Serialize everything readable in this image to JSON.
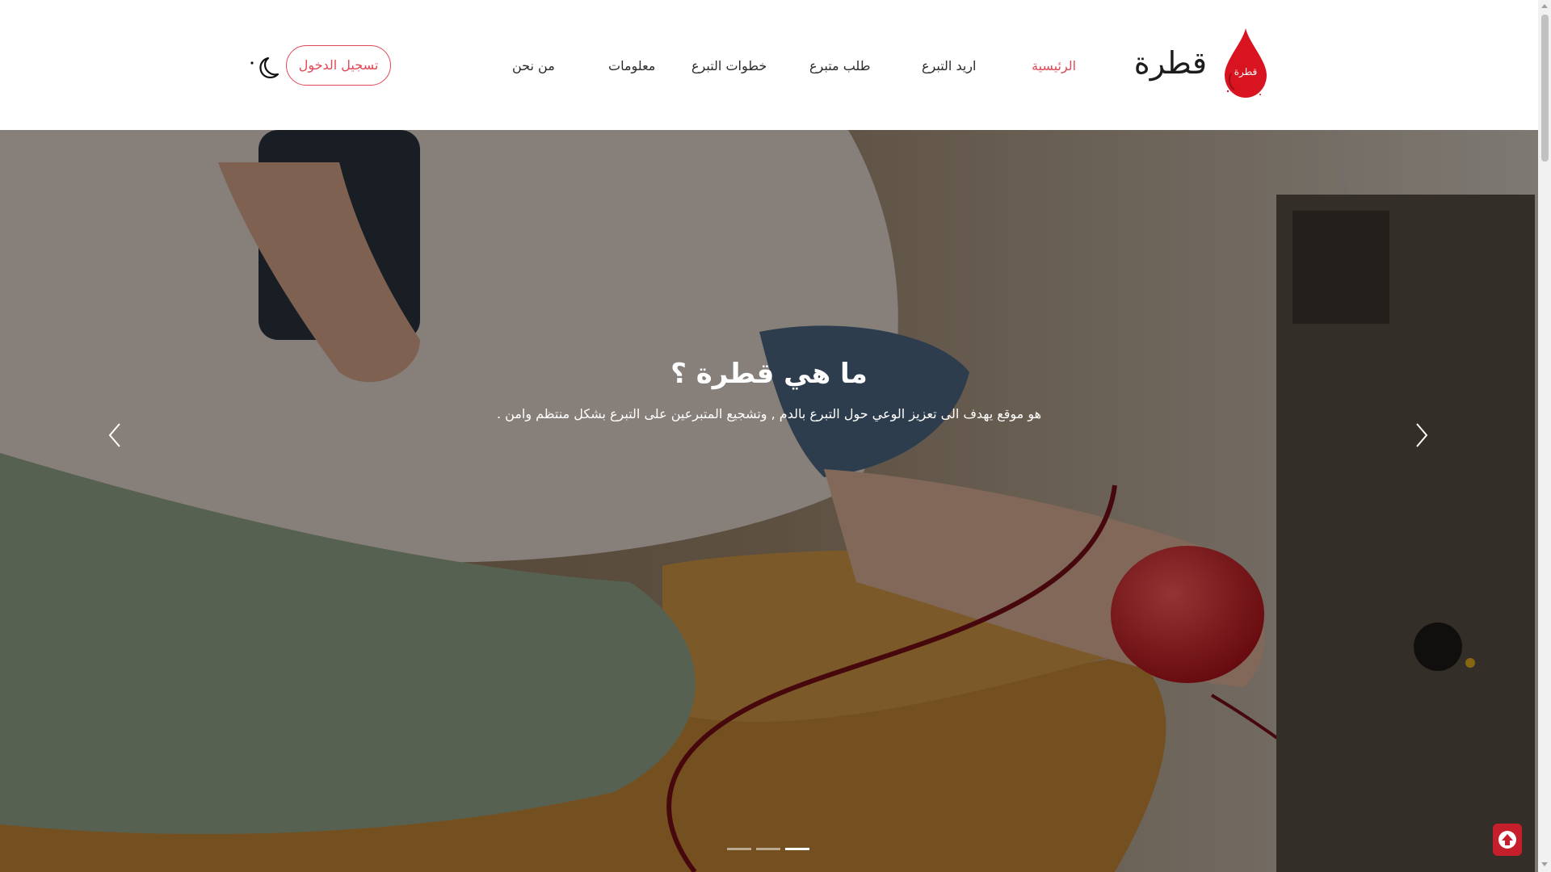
{
  "brand": {
    "name": "قطرة",
    "drop_label": "قطرة",
    "accent_color": "#e04a56",
    "drop_color": "#d7141f"
  },
  "nav": {
    "items": [
      {
        "label": "الرئيسية",
        "active": true
      },
      {
        "label": "اريد التبرع",
        "active": false
      },
      {
        "label": "طلب متبرع",
        "active": false
      },
      {
        "label": "خطوات التبرع",
        "active": false
      },
      {
        "label": "معلومات",
        "active": false
      },
      {
        "label": "من نحن",
        "active": false
      }
    ],
    "login_label": "تسجيل الدخول",
    "theme_toggle_icon": "moon-icon"
  },
  "hero": {
    "title": "ما هي قطرة ؟",
    "subtitle": "هو موقع يهدف الى تعزيز الوعي حول التبرع بالدم , وتشجيع المتبرعين على التبرع بشكل منتظم وامن .",
    "prev_icon": "chevron-left-icon",
    "next_icon": "chevron-right-icon",
    "slides_count": 3,
    "active_slide": 3
  },
  "scroll_top": {
    "icon": "arrow-up-icon",
    "color": "#c61f2b"
  }
}
